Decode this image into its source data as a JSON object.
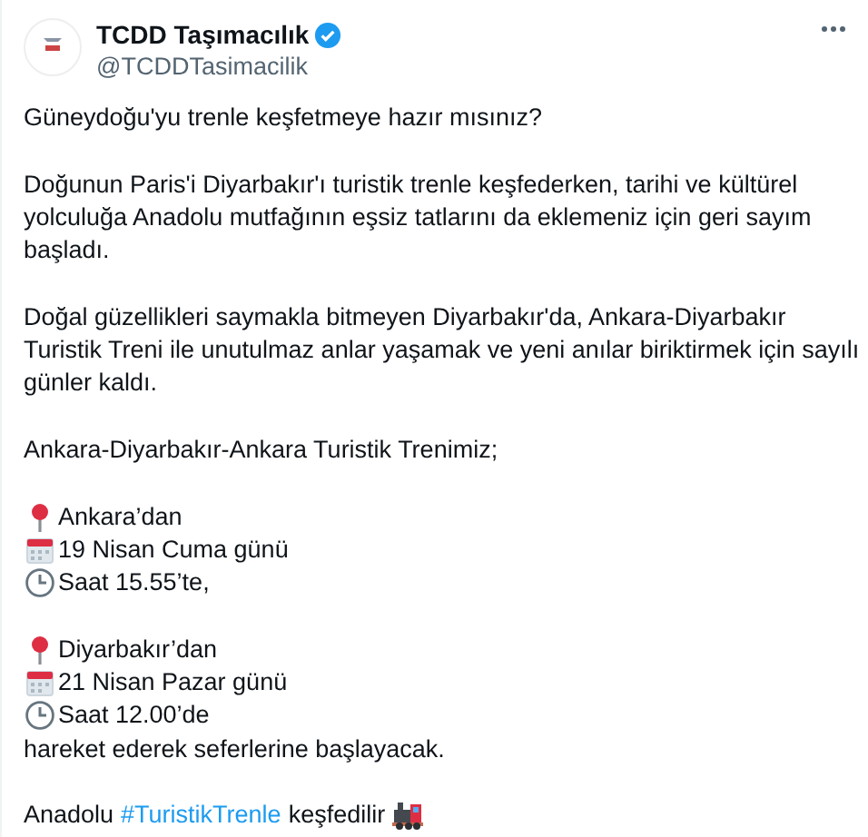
{
  "author": {
    "name": "TCDD Taşımacılık",
    "verified": true,
    "handle": "@TCDDTasimacilik"
  },
  "paragraphs": [
    {
      "kind": "text",
      "lines": [
        "Güneydoğu'yu trenle keşfetmeye hazır mısınız?"
      ]
    },
    {
      "kind": "text",
      "lines": [
        "Doğunun Paris'i Diyarbakır'ı turistik trenle keşfederken, tarihi ve kültürel",
        "yolculuğa Anadolu mutfağının eşsiz tatlarını da eklemeniz için geri sayım",
        "başladı."
      ]
    },
    {
      "kind": "text",
      "lines": [
        "Doğal güzellikleri saymakla bitmeyen Diyarbakır'da, Ankara-Diyarbakır",
        "Turistik Treni ile unutulmaz anlar yaşamak ve yeni anılar biriktirmek için sayılı",
        "günler kaldı."
      ]
    },
    {
      "kind": "text",
      "lines": [
        "Ankara-Diyarbakır-Ankara Turistik Trenimiz;"
      ]
    },
    {
      "kind": "schedule",
      "items": [
        {
          "kind": "pin",
          "text": "Ankara’dan"
        },
        {
          "kind": "calendar",
          "text": "19 Nisan Cuma günü"
        },
        {
          "kind": "clock",
          "text": "Saat 15.55’te,"
        }
      ]
    },
    {
      "kind": "schedule",
      "items": [
        {
          "kind": "pin",
          "text": "Diyarbakır’dan"
        },
        {
          "kind": "calendar",
          "text": "21 Nisan Pazar günü"
        },
        {
          "kind": "clock",
          "text": "Saat 12.00’de"
        },
        {
          "kind": "plain",
          "text": "hareket ederek seferlerine başlayacak."
        }
      ]
    },
    {
      "kind": "closing",
      "before": "Anadolu",
      "hashtag": "#TuristikTrenle",
      "after": "keşfedilir"
    }
  ]
}
